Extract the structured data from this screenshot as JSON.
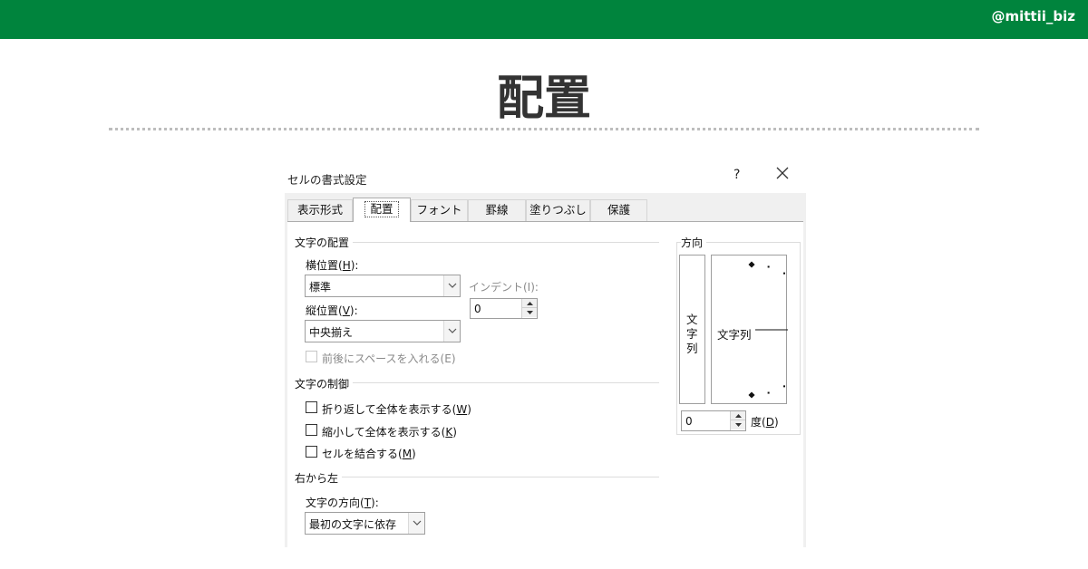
{
  "header": {
    "handle": "@mittii_biz",
    "title": "配置"
  },
  "colors": {
    "brand_green": "#00843d",
    "dial_marker": "#c0392b"
  },
  "dialog": {
    "title": "セルの書式設定",
    "help_label": "?",
    "close_icon": "close-icon",
    "tabs": [
      {
        "label": "表示形式"
      },
      {
        "label": "配置"
      },
      {
        "label": "フォント"
      },
      {
        "label": "罫線"
      },
      {
        "label": "塗りつぶし"
      },
      {
        "label": "保護"
      }
    ],
    "active_tab": "配置",
    "text_alignment": {
      "group_title": "文字の配置",
      "horizontal_label": "横位置(",
      "horizontal_key": "H",
      "horizontal_suffix": "):",
      "horizontal_value": "標準",
      "indent_label": "インデント(I):",
      "indent_value": "0",
      "vertical_label": "縦位置(",
      "vertical_key": "V",
      "vertical_suffix": "):",
      "vertical_value": "中央揃え",
      "justify_distributed_label": "前後にスペースを入れる(E)"
    },
    "text_control": {
      "group_title": "文字の制御",
      "wrap_label": "折り返して全体を表示する(",
      "wrap_key": "W",
      "wrap_suffix": ")",
      "shrink_label": "縮小して全体を表示する(",
      "shrink_key": "K",
      "shrink_suffix": ")",
      "merge_label": "セルを結合する(",
      "merge_key": "M",
      "merge_suffix": ")"
    },
    "right_to_left": {
      "group_title": "右から左",
      "direction_label": "文字の方向(",
      "direction_key": "T",
      "direction_suffix": "):",
      "direction_value": "最初の文字に依存"
    },
    "orientation": {
      "group_title": "方向",
      "vertical_chars": [
        "文",
        "字",
        "列"
      ],
      "dial_text": "文字列",
      "degrees_value": "0",
      "degrees_label": "度(",
      "degrees_key": "D",
      "degrees_suffix": ")"
    }
  }
}
